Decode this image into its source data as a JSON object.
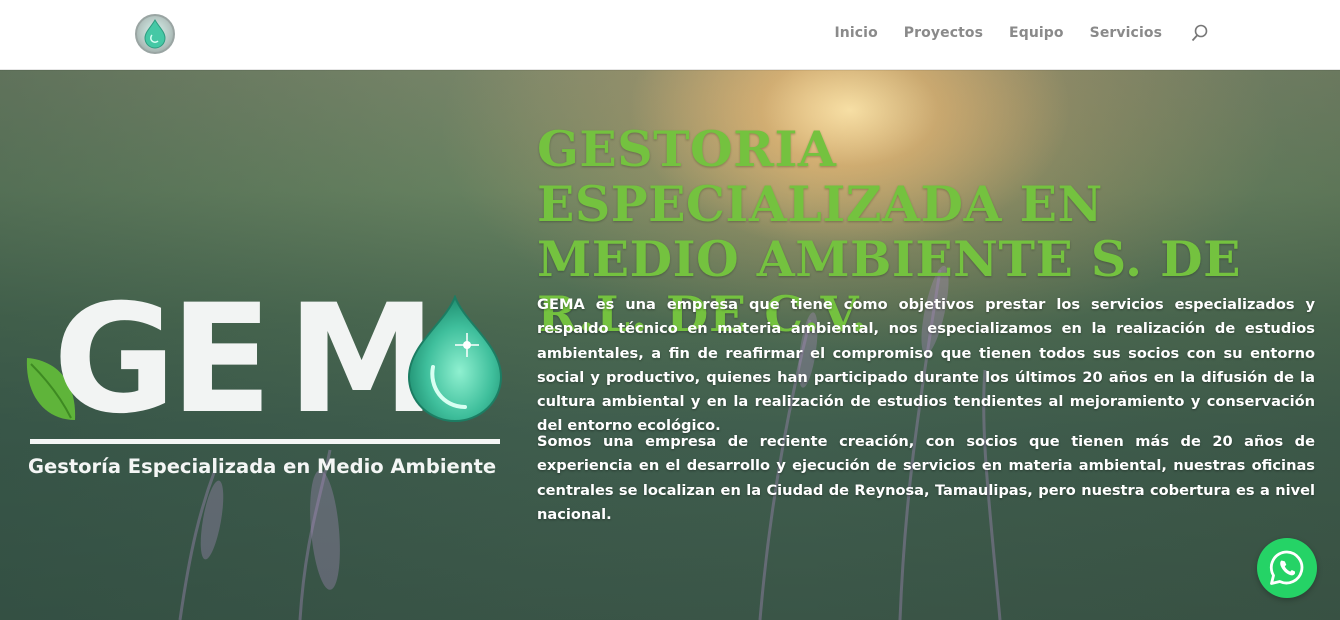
{
  "header": {
    "logo_icon": "water-drop-logo-icon",
    "nav": [
      {
        "label": "Inicio"
      },
      {
        "label": "Proyectos"
      },
      {
        "label": "Equipo"
      },
      {
        "label": "Servicios"
      }
    ],
    "search_icon": "search-icon"
  },
  "hero": {
    "title": "GESTORIA ESPECIALIZADA EN MEDIO AMBIENTE S. DE R.L. DE C.V.",
    "paragraph1": "GEMA es una empresa que tiene como objetivos prestar los servicios especializados y respaldo técnico en materia ambiental, nos especializamos en la realización de estudios ambientales, a fin de reafirmar el compromiso que tienen todos sus socios con su entorno social y productivo, quienes han participado durante los últimos 20 años en la difusión de la cultura ambiental y en la realización de estudios tendientes al mejoramiento y conservación del entorno ecológico.",
    "paragraph2": "Somos una empresa de reciente creación, con socios que tienen más de 20 años de experiencia en el desarrollo y ejecución de servicios en materia ambiental, nuestras oficinas centrales se localizan en la Ciudad de Reynosa, Tamaulipas, pero nuestra cobertura es a nivel nacional.",
    "logo": {
      "letters": [
        "G",
        "E",
        "M"
      ],
      "subtitle": "Gestoría Especializada en Medio Ambiente"
    }
  },
  "whatsapp_icon": "whatsapp-icon",
  "colors": {
    "title_green": "#74c23f",
    "whatsapp_green": "#25d366",
    "nav_gray": "#8a8a8a",
    "drop_teal": "#3fbf9c"
  }
}
